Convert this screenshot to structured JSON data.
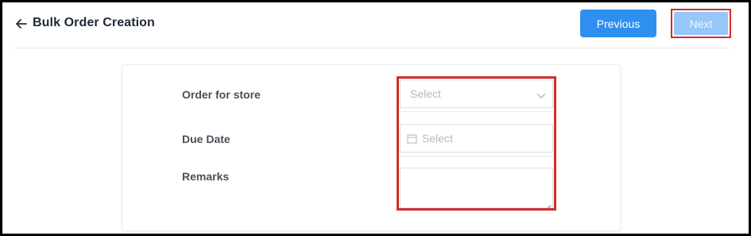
{
  "header": {
    "title": "Bulk Order Creation",
    "back_icon": "arrow-left-icon",
    "previous_label": "Previous",
    "next_label": "Next"
  },
  "form": {
    "fields": [
      {
        "label": "Order for store",
        "type": "select",
        "placeholder": "Select",
        "icon": "chevron-down-icon"
      },
      {
        "label": "Due Date",
        "type": "date",
        "placeholder": "Select",
        "icon": "calendar-icon"
      },
      {
        "label": "Remarks",
        "type": "textarea",
        "placeholder": ""
      }
    ]
  },
  "colors": {
    "primary": "#2f8ff0",
    "primary_disabled": "#95c7f8",
    "highlight": "#d22c2c",
    "title": "#1f2a37",
    "label": "#4a4f57"
  }
}
